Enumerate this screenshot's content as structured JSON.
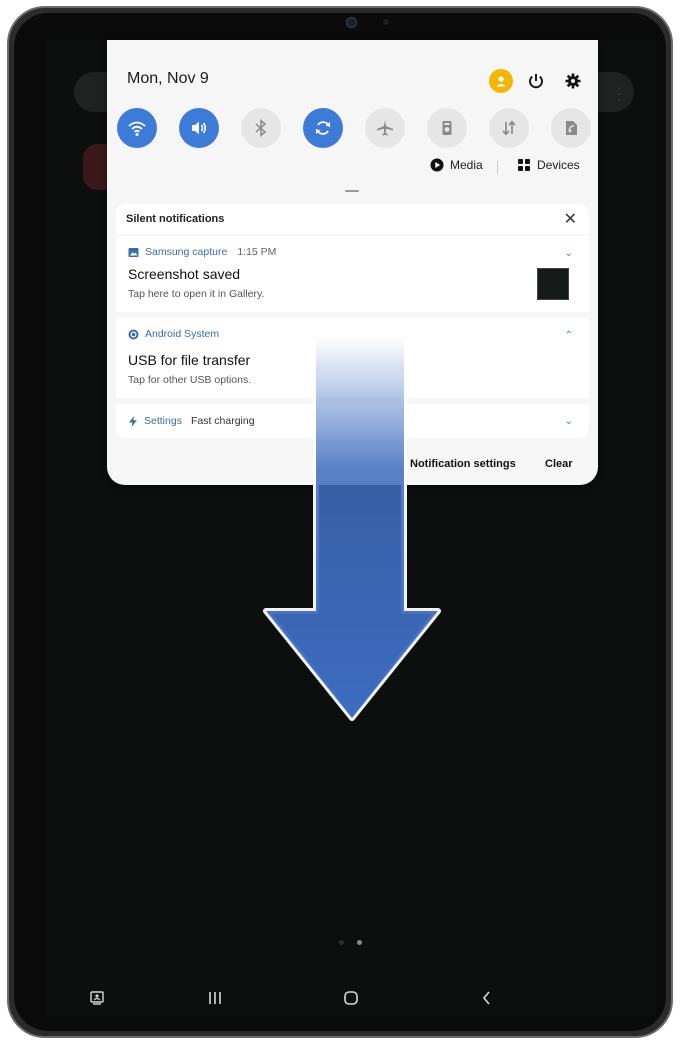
{
  "status": {
    "date": "Mon, Nov 9"
  },
  "quick_settings": {
    "tiles": [
      {
        "icon": "wifi-icon",
        "active": true
      },
      {
        "icon": "sound-icon",
        "active": true
      },
      {
        "icon": "bluetooth-icon",
        "active": false
      },
      {
        "icon": "auto-rotate-icon",
        "active": true
      },
      {
        "icon": "airplane-mode-icon",
        "active": false
      },
      {
        "icon": "flashlight-icon",
        "active": false
      },
      {
        "icon": "mobile-data-icon",
        "active": false
      },
      {
        "icon": "power-saving-icon",
        "active": false
      }
    ],
    "media_label": "Media",
    "devices_label": "Devices"
  },
  "notifications": {
    "section_title": "Silent notifications",
    "items": [
      {
        "app": "Samsung capture",
        "time": "1:15 PM",
        "title": "Screenshot saved",
        "text": "Tap here to open it in Gallery."
      },
      {
        "app": "Android System",
        "title": "USB for file transfer",
        "text": "Tap for other USB options."
      },
      {
        "app": "Settings",
        "summary": "Fast charging"
      }
    ],
    "settings_button": "Notification settings",
    "clear_button": "Clear"
  },
  "colors": {
    "accent": "#3e7bd6",
    "app_label": "#3a6da8",
    "arrow_fill": "#3d6cbf",
    "avatar": "#f2b705"
  }
}
